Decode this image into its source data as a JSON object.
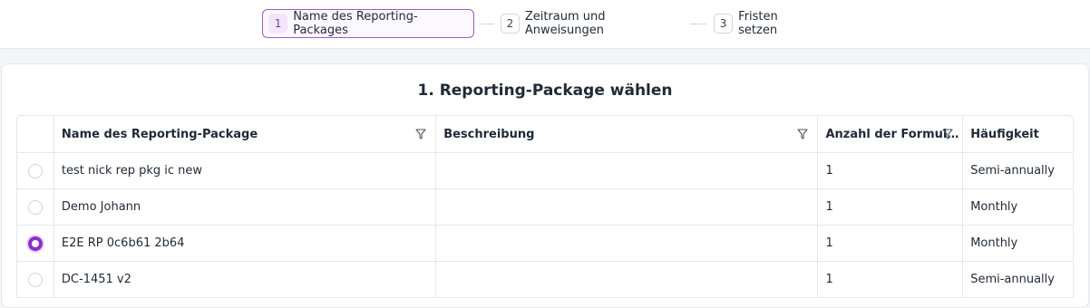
{
  "stepper": {
    "steps": [
      {
        "num": "1",
        "label": "Name des Reporting-Packages",
        "active": true
      },
      {
        "num": "2",
        "label": "Zeitraum und Anweisungen",
        "active": false
      },
      {
        "num": "3",
        "label": "Fristen setzen",
        "active": false
      }
    ]
  },
  "card": {
    "title": "1. Reporting-Package wählen"
  },
  "table": {
    "columns": [
      {
        "label": "Name des Reporting-Package",
        "filter_icon": "filter-icon"
      },
      {
        "label": "Beschreibung",
        "filter_icon": "filter-icon"
      },
      {
        "label": "Anzahl der Formul…",
        "filter_icon": "filter-icon"
      },
      {
        "label": "Häufigkeit"
      }
    ],
    "rows": [
      {
        "selected": false,
        "name": "test nick rep pkg ic new",
        "description": "",
        "count": "1",
        "frequency": "Semi-annually"
      },
      {
        "selected": false,
        "name": "Demo Johann",
        "description": "",
        "count": "1",
        "frequency": "Monthly"
      },
      {
        "selected": true,
        "name": "E2E RP 0c6b61 2b64",
        "description": "",
        "count": "1",
        "frequency": "Monthly"
      },
      {
        "selected": false,
        "name": "DC-1451 v2",
        "description": "",
        "count": "1",
        "frequency": "Semi-annually"
      }
    ]
  },
  "colors": {
    "accent": "#8b2fc9",
    "active_step_border": "#9b5cc8"
  }
}
